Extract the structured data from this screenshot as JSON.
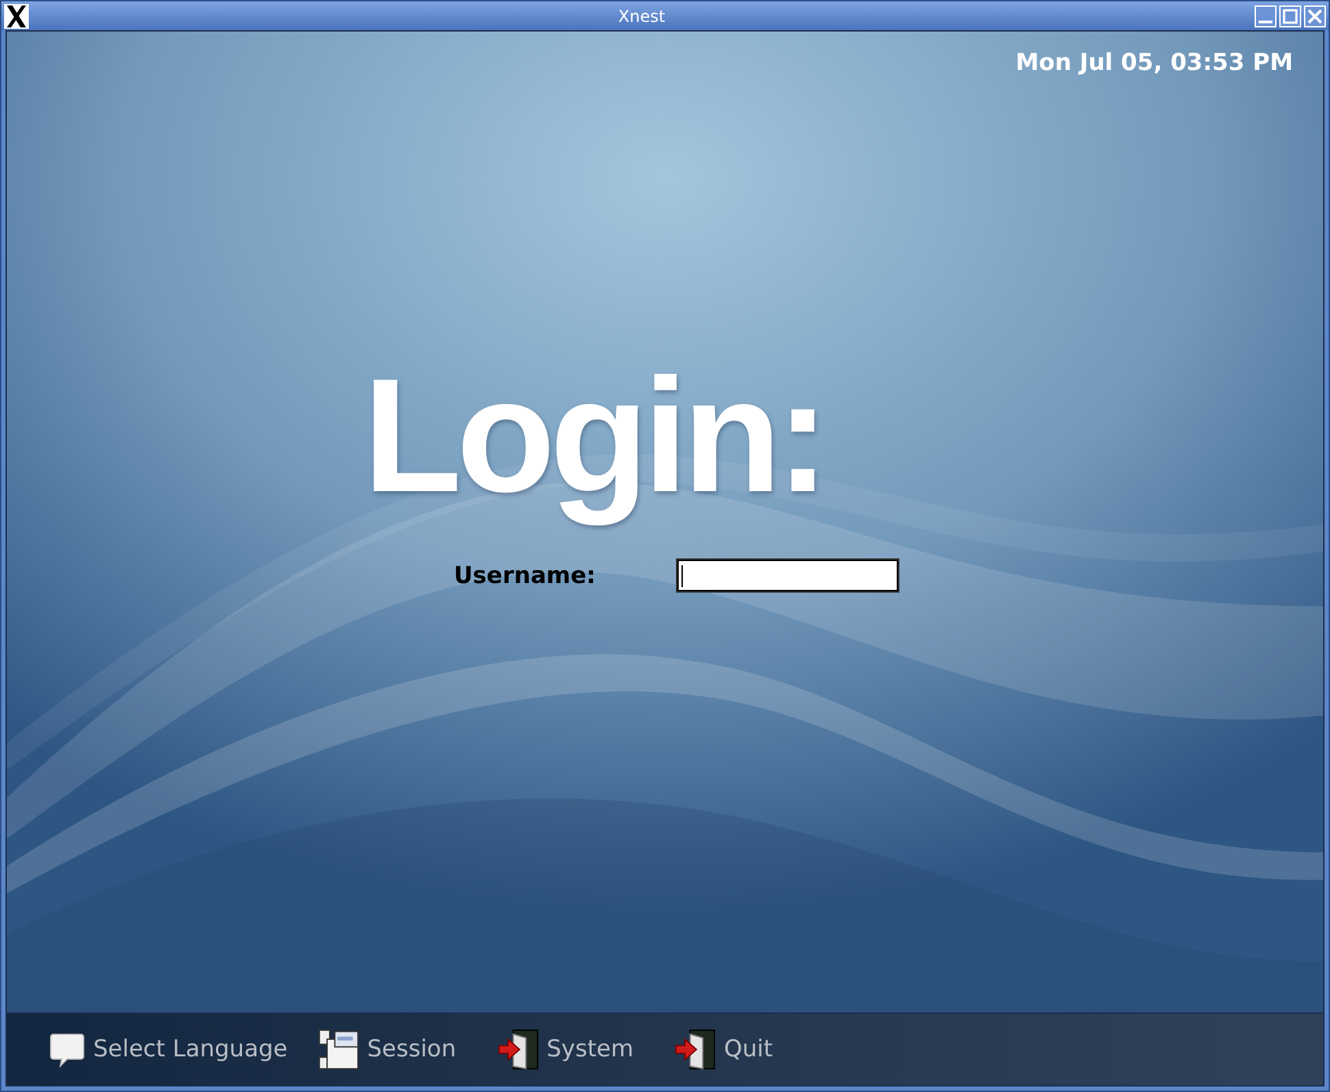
{
  "window": {
    "title": "Xnest"
  },
  "clock": "Mon Jul 05, 03:53 PM",
  "heading": "Login:",
  "username": {
    "label": "Username:",
    "focused": true
  },
  "bottom_bar": [
    {
      "label": "Select Language",
      "kind": "language"
    },
    {
      "label": "Session",
      "kind": "session"
    },
    {
      "label": "System",
      "kind": "system"
    },
    {
      "label": "Quit",
      "kind": "quit"
    }
  ]
}
